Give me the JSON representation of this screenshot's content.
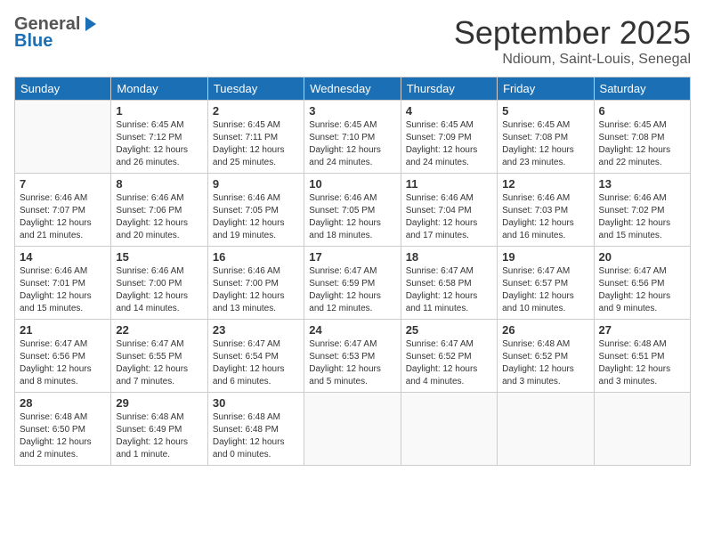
{
  "header": {
    "logo_general": "General",
    "logo_blue": "Blue",
    "month_title": "September 2025",
    "location": "Ndioum, Saint-Louis, Senegal"
  },
  "weekdays": [
    "Sunday",
    "Monday",
    "Tuesday",
    "Wednesday",
    "Thursday",
    "Friday",
    "Saturday"
  ],
  "weeks": [
    [
      {
        "day": "",
        "info": ""
      },
      {
        "day": "1",
        "info": "Sunrise: 6:45 AM\nSunset: 7:12 PM\nDaylight: 12 hours\nand 26 minutes."
      },
      {
        "day": "2",
        "info": "Sunrise: 6:45 AM\nSunset: 7:11 PM\nDaylight: 12 hours\nand 25 minutes."
      },
      {
        "day": "3",
        "info": "Sunrise: 6:45 AM\nSunset: 7:10 PM\nDaylight: 12 hours\nand 24 minutes."
      },
      {
        "day": "4",
        "info": "Sunrise: 6:45 AM\nSunset: 7:09 PM\nDaylight: 12 hours\nand 24 minutes."
      },
      {
        "day": "5",
        "info": "Sunrise: 6:45 AM\nSunset: 7:08 PM\nDaylight: 12 hours\nand 23 minutes."
      },
      {
        "day": "6",
        "info": "Sunrise: 6:45 AM\nSunset: 7:08 PM\nDaylight: 12 hours\nand 22 minutes."
      }
    ],
    [
      {
        "day": "7",
        "info": "Sunrise: 6:46 AM\nSunset: 7:07 PM\nDaylight: 12 hours\nand 21 minutes."
      },
      {
        "day": "8",
        "info": "Sunrise: 6:46 AM\nSunset: 7:06 PM\nDaylight: 12 hours\nand 20 minutes."
      },
      {
        "day": "9",
        "info": "Sunrise: 6:46 AM\nSunset: 7:05 PM\nDaylight: 12 hours\nand 19 minutes."
      },
      {
        "day": "10",
        "info": "Sunrise: 6:46 AM\nSunset: 7:05 PM\nDaylight: 12 hours\nand 18 minutes."
      },
      {
        "day": "11",
        "info": "Sunrise: 6:46 AM\nSunset: 7:04 PM\nDaylight: 12 hours\nand 17 minutes."
      },
      {
        "day": "12",
        "info": "Sunrise: 6:46 AM\nSunset: 7:03 PM\nDaylight: 12 hours\nand 16 minutes."
      },
      {
        "day": "13",
        "info": "Sunrise: 6:46 AM\nSunset: 7:02 PM\nDaylight: 12 hours\nand 15 minutes."
      }
    ],
    [
      {
        "day": "14",
        "info": "Sunrise: 6:46 AM\nSunset: 7:01 PM\nDaylight: 12 hours\nand 15 minutes."
      },
      {
        "day": "15",
        "info": "Sunrise: 6:46 AM\nSunset: 7:00 PM\nDaylight: 12 hours\nand 14 minutes."
      },
      {
        "day": "16",
        "info": "Sunrise: 6:46 AM\nSunset: 7:00 PM\nDaylight: 12 hours\nand 13 minutes."
      },
      {
        "day": "17",
        "info": "Sunrise: 6:47 AM\nSunset: 6:59 PM\nDaylight: 12 hours\nand 12 minutes."
      },
      {
        "day": "18",
        "info": "Sunrise: 6:47 AM\nSunset: 6:58 PM\nDaylight: 12 hours\nand 11 minutes."
      },
      {
        "day": "19",
        "info": "Sunrise: 6:47 AM\nSunset: 6:57 PM\nDaylight: 12 hours\nand 10 minutes."
      },
      {
        "day": "20",
        "info": "Sunrise: 6:47 AM\nSunset: 6:56 PM\nDaylight: 12 hours\nand 9 minutes."
      }
    ],
    [
      {
        "day": "21",
        "info": "Sunrise: 6:47 AM\nSunset: 6:56 PM\nDaylight: 12 hours\nand 8 minutes."
      },
      {
        "day": "22",
        "info": "Sunrise: 6:47 AM\nSunset: 6:55 PM\nDaylight: 12 hours\nand 7 minutes."
      },
      {
        "day": "23",
        "info": "Sunrise: 6:47 AM\nSunset: 6:54 PM\nDaylight: 12 hours\nand 6 minutes."
      },
      {
        "day": "24",
        "info": "Sunrise: 6:47 AM\nSunset: 6:53 PM\nDaylight: 12 hours\nand 5 minutes."
      },
      {
        "day": "25",
        "info": "Sunrise: 6:47 AM\nSunset: 6:52 PM\nDaylight: 12 hours\nand 4 minutes."
      },
      {
        "day": "26",
        "info": "Sunrise: 6:48 AM\nSunset: 6:52 PM\nDaylight: 12 hours\nand 3 minutes."
      },
      {
        "day": "27",
        "info": "Sunrise: 6:48 AM\nSunset: 6:51 PM\nDaylight: 12 hours\nand 3 minutes."
      }
    ],
    [
      {
        "day": "28",
        "info": "Sunrise: 6:48 AM\nSunset: 6:50 PM\nDaylight: 12 hours\nand 2 minutes."
      },
      {
        "day": "29",
        "info": "Sunrise: 6:48 AM\nSunset: 6:49 PM\nDaylight: 12 hours\nand 1 minute."
      },
      {
        "day": "30",
        "info": "Sunrise: 6:48 AM\nSunset: 6:48 PM\nDaylight: 12 hours\nand 0 minutes."
      },
      {
        "day": "",
        "info": ""
      },
      {
        "day": "",
        "info": ""
      },
      {
        "day": "",
        "info": ""
      },
      {
        "day": "",
        "info": ""
      }
    ]
  ]
}
